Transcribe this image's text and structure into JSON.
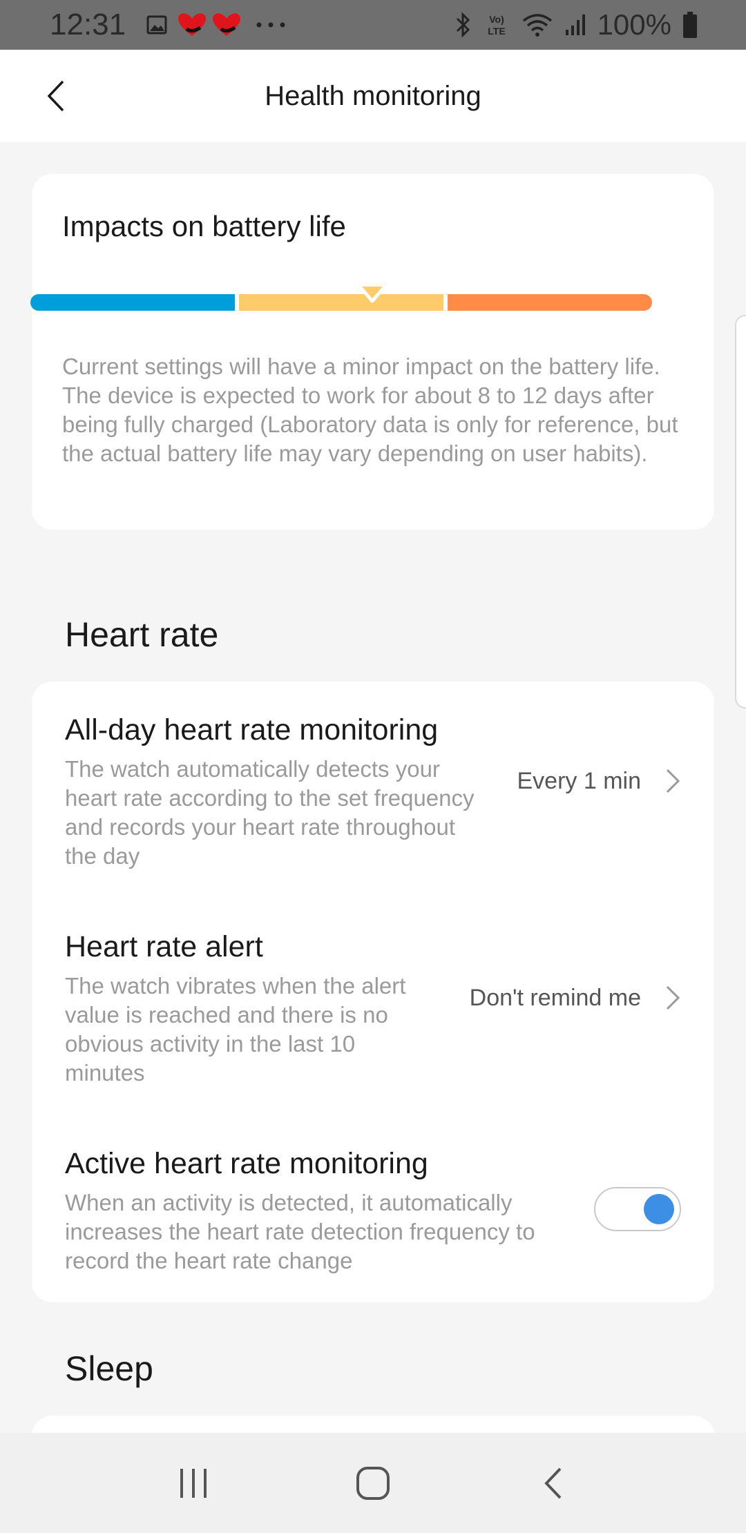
{
  "status_bar": {
    "time": "12:31",
    "battery_percent": "100%",
    "left_icons": [
      "gallery-icon",
      "hearts-notification-icon",
      "more-dots-icon"
    ],
    "right_icons": [
      "bluetooth-icon",
      "volte-icon",
      "wifi-icon",
      "signal-icon",
      "battery-icon"
    ]
  },
  "header": {
    "title": "Health monitoring",
    "back_icon": "chevron-left-icon"
  },
  "battery_card": {
    "title": "Impacts on battery life",
    "impact_level": "medium",
    "segments": [
      {
        "level": "low",
        "color": "#009fdb"
      },
      {
        "level": "medium",
        "color": "#fdcb6a"
      },
      {
        "level": "high",
        "color": "#ff8b47"
      }
    ],
    "description": "Current settings will have a minor impact on the battery life. The device is expected to work for about 8 to 12 days after being fully charged (Laboratory data is only for reference, but the actual battery life may vary depending on user habits)."
  },
  "heart_rate": {
    "section_title": "Heart rate",
    "items": [
      {
        "title": "All-day heart rate monitoring",
        "description": "The watch automatically detects your heart rate according to the set frequency and records your heart rate throughout the day",
        "value": "Every 1 min"
      },
      {
        "title": "Heart rate alert",
        "description": "The watch vibrates when the alert value is reached and there is no obvious activity in the last 10 minutes",
        "value": "Don't remind me"
      },
      {
        "title": "Active heart rate monitoring",
        "description": "When an activity is detected, it automatically increases the heart rate detection frequency to record the heart rate change",
        "toggle_on": true
      }
    ]
  },
  "sleep": {
    "section_title": "Sleep"
  },
  "colors": {
    "toggle_on": "#3d8fe6",
    "background": "#f5f5f5",
    "card": "#ffffff"
  },
  "nav_bar": {
    "buttons": [
      "recent-apps-icon",
      "home-icon",
      "back-icon"
    ]
  }
}
